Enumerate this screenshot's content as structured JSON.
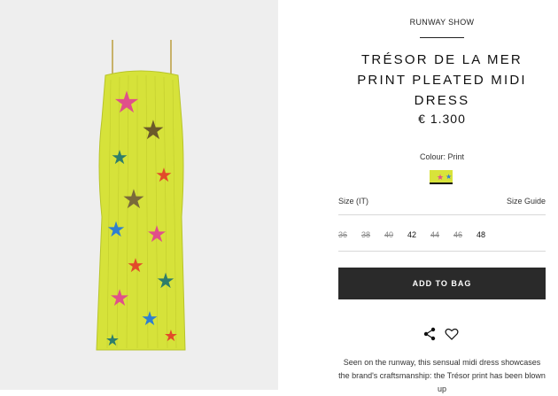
{
  "product": {
    "eyebrow": "RUNWAY SHOW",
    "title": "TRÉSOR DE LA MER PRINT PLEATED MIDI DRESS",
    "price": "€ 1.300",
    "colour_label": "Colour: Print",
    "swatch_color": "#d8e33a"
  },
  "size": {
    "label": "Size  (IT)",
    "guide_label": "Size Guide",
    "options": [
      {
        "label": "36",
        "available": false
      },
      {
        "label": "38",
        "available": false
      },
      {
        "label": "40",
        "available": false
      },
      {
        "label": "42",
        "available": true
      },
      {
        "label": "44",
        "available": false
      },
      {
        "label": "46",
        "available": false
      },
      {
        "label": "48",
        "available": true
      }
    ]
  },
  "actions": {
    "add_to_bag": "ADD TO BAG",
    "share_icon": "share-icon",
    "wishlist_icon": "heart-icon"
  },
  "description": "Seen on the runway, this sensual midi dress showcases the brand's craftsmanship: the Trésor print has been blown up",
  "colors": {
    "button_bg": "#2a2a2a",
    "image_bg": "#eeeeee",
    "dress_base": "#d7e23c"
  }
}
